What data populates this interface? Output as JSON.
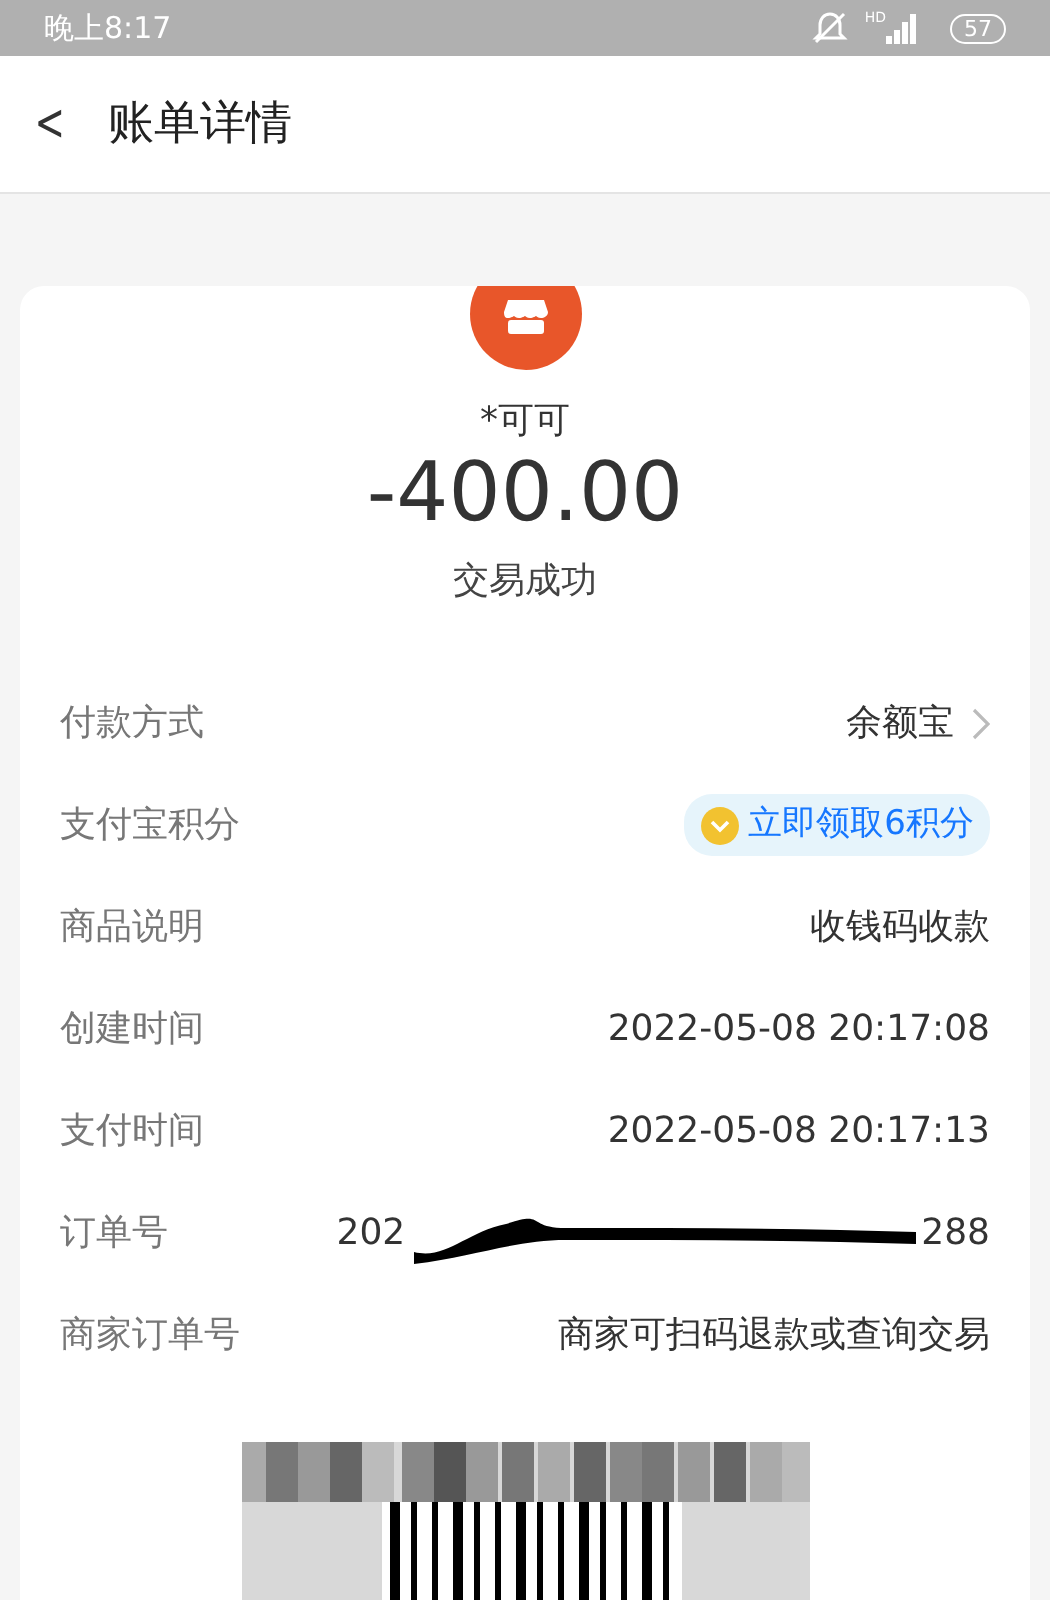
{
  "status_bar": {
    "time": "晚上8:17",
    "network": "HD",
    "battery": "57"
  },
  "header": {
    "back": "<",
    "title": "账单详情"
  },
  "summary": {
    "payee": "*可可",
    "amount": "-400.00",
    "status": "交易成功"
  },
  "rows": [
    {
      "kind": "link",
      "label": "付款方式",
      "value": "余额宝"
    },
    {
      "kind": "points",
      "label": "支付宝积分",
      "value": "立即领取6积分"
    },
    {
      "kind": "text",
      "label": "商品说明",
      "value": "收钱码收款"
    },
    {
      "kind": "text",
      "label": "创建时间",
      "value": "2022-05-08 20:17:08"
    },
    {
      "kind": "text",
      "label": "支付时间",
      "value": "2022-05-08 20:17:13"
    },
    {
      "kind": "redacted",
      "label": "订单号",
      "value_start": "202",
      "value_end": "288"
    },
    {
      "kind": "text",
      "label": "商家订单号",
      "value": "商家可扫码退款或查询交易"
    }
  ]
}
